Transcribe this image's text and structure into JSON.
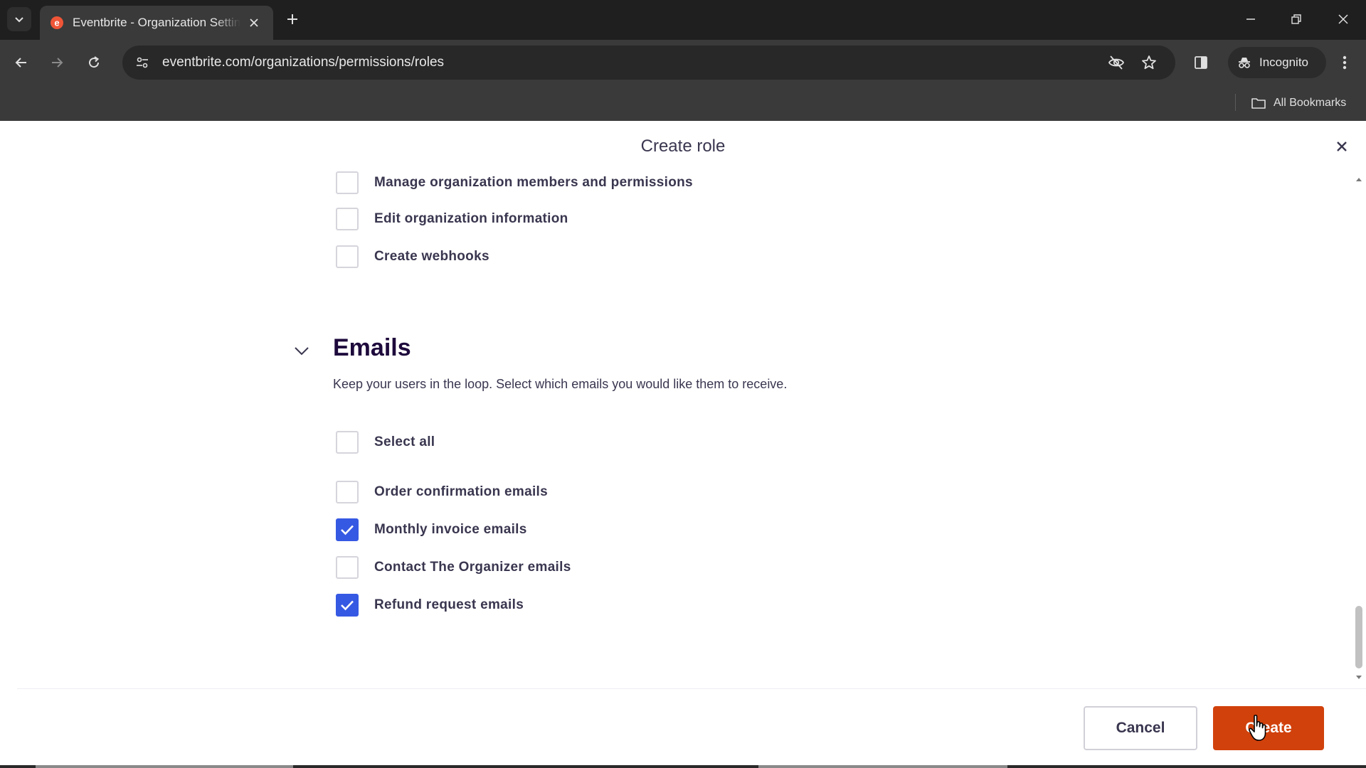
{
  "browser": {
    "tab_title": "Eventbrite - Organization Settings",
    "url": "eventbrite.com/organizations/permissions/roles",
    "incognito_label": "Incognito",
    "bookmarks_label": "All Bookmarks"
  },
  "modal": {
    "title": "Create role",
    "permissions": [
      {
        "label": "Manage organization members and permissions",
        "checked": false
      },
      {
        "label": "Edit organization information",
        "checked": false
      },
      {
        "label": "Create webhooks",
        "checked": false
      }
    ],
    "emails_section": {
      "title": "Emails",
      "description": "Keep your users in the loop. Select which emails you would like them to receive.",
      "select_all_label": "Select all",
      "options": [
        {
          "label": "Order confirmation emails",
          "checked": false
        },
        {
          "label": "Monthly invoice emails",
          "checked": true
        },
        {
          "label": "Contact The Organizer emails",
          "checked": false
        },
        {
          "label": "Refund request emails",
          "checked": true
        }
      ]
    },
    "footer": {
      "cancel_label": "Cancel",
      "create_label": "Create"
    }
  },
  "colors": {
    "accent_blue": "#3659e3",
    "create_orange": "#d1410c",
    "text_dark": "#39364f"
  }
}
